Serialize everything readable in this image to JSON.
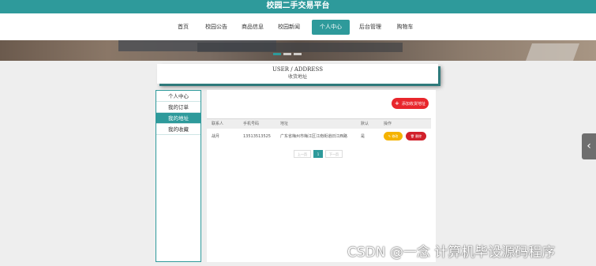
{
  "site": {
    "title": "校园二手交易平台"
  },
  "nav": {
    "items": [
      {
        "label": "首页",
        "active": false
      },
      {
        "label": "校园公告",
        "active": false
      },
      {
        "label": "商品信息",
        "active": false
      },
      {
        "label": "校园新闻",
        "active": false
      },
      {
        "label": "个人中心",
        "active": true
      },
      {
        "label": "后台管理",
        "active": false
      },
      {
        "label": "购物车",
        "active": false
      }
    ]
  },
  "page_title": {
    "en": "USER / ADDRESS",
    "cn": "收货地址"
  },
  "sidebar": {
    "items": [
      {
        "label": "个人中心",
        "active": false
      },
      {
        "label": "我的订单",
        "active": false
      },
      {
        "label": "我的地址",
        "active": true
      },
      {
        "label": "我的收藏",
        "active": false
      }
    ]
  },
  "content": {
    "add_button": "添加收货地址",
    "columns": [
      "联系人",
      "手机号码",
      "地址",
      "默认",
      "操作"
    ],
    "rows": [
      {
        "contact": "战月",
        "phone": "13513513525",
        "address": "广东省梅州市梅江区江南街道旧江西路",
        "default": "是",
        "edit": "修改",
        "delete": "删除"
      }
    ],
    "pagination": {
      "prev": "上一页",
      "current": "1",
      "next": "下一页"
    }
  },
  "watermark": "CSDN @一念 计算机毕设源码程序",
  "colors": {
    "primary": "#2e9a9b",
    "danger": "#e8262c",
    "warning": "#f5b300"
  }
}
